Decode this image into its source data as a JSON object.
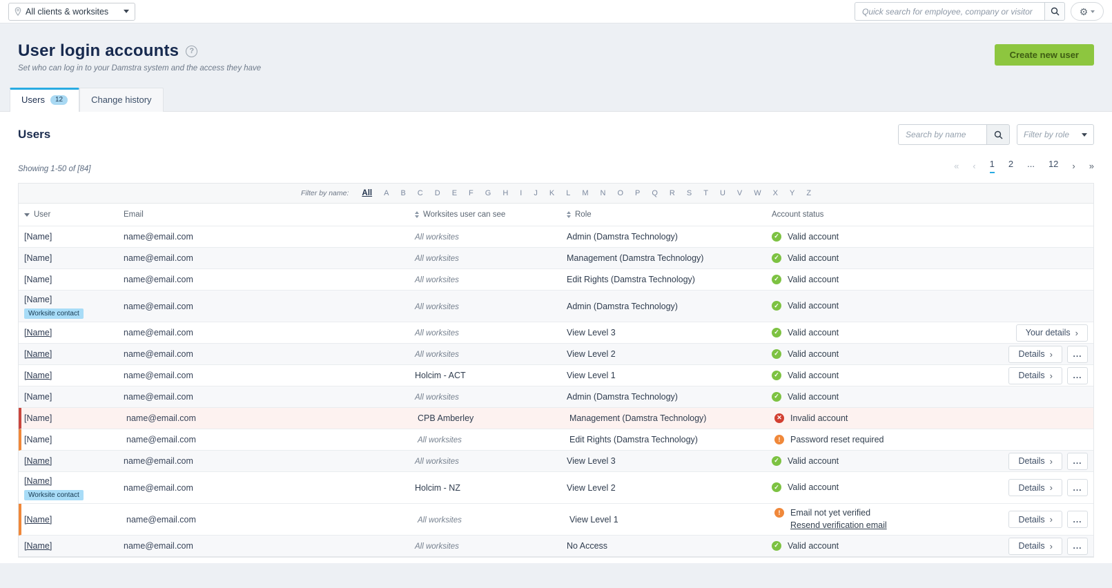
{
  "topbar": {
    "scope_selector": {
      "label": "All clients & worksites"
    },
    "quick_search": {
      "placeholder": "Quick search for employee, company or visitor"
    }
  },
  "header": {
    "title": "User login accounts",
    "help": "?",
    "subtitle": "Set who can log in to your Damstra system and the access they have",
    "create_button": "Create new user"
  },
  "tabs": {
    "users_label": "Users",
    "users_badge": "12",
    "history_label": "Change history"
  },
  "users_section": {
    "heading": "Users",
    "search_placeholder": "Search by name",
    "role_filter_placeholder": "Filter by role",
    "showing": "Showing 1-50 of [84]",
    "pagination": {
      "first": "«",
      "prev": "‹",
      "next": "›",
      "last": "»",
      "pages": [
        {
          "label": "1",
          "active": true
        },
        {
          "label": "2",
          "active": false
        },
        {
          "label": "...",
          "active": false,
          "dots": true
        },
        {
          "label": "12",
          "active": false
        }
      ]
    },
    "name_filter": {
      "label": "Filter by name:",
      "all": "All",
      "letters": [
        "A",
        "B",
        "C",
        "D",
        "E",
        "F",
        "G",
        "H",
        "I",
        "J",
        "K",
        "L",
        "M",
        "N",
        "O",
        "P",
        "Q",
        "R",
        "S",
        "T",
        "U",
        "V",
        "W",
        "X",
        "Y",
        "Z"
      ]
    }
  },
  "table": {
    "columns": {
      "user": "User",
      "email": "Email",
      "worksites": "Worksites user can see",
      "role": "Role",
      "status": "Account status"
    },
    "action_labels": {
      "your_details": "Your details",
      "details": "Details",
      "menu": "...",
      "chevron": "›"
    },
    "rows": [
      {
        "user": "[Name]",
        "link": false,
        "badge": null,
        "email": "name@email.com",
        "worksites": "All worksites",
        "all_worksites": true,
        "role": "Admin (Damstra Technology)",
        "status": {
          "type": "valid",
          "text": "Valid account"
        },
        "actions": [],
        "stripe": false,
        "accent": null,
        "tall": false
      },
      {
        "user": "[Name]",
        "link": false,
        "badge": null,
        "email": "name@email.com",
        "worksites": "All worksites",
        "all_worksites": true,
        "role": "Management (Damstra Technology)",
        "status": {
          "type": "valid",
          "text": "Valid account"
        },
        "actions": [],
        "stripe": true,
        "accent": null,
        "tall": false
      },
      {
        "user": "[Name]",
        "link": false,
        "badge": null,
        "email": "name@email.com",
        "worksites": "All worksites",
        "all_worksites": true,
        "role": "Edit Rights (Damstra Technology)",
        "status": {
          "type": "valid",
          "text": "Valid account"
        },
        "actions": [],
        "stripe": false,
        "accent": null,
        "tall": false
      },
      {
        "user": "[Name]",
        "link": false,
        "badge": "Worksite contact",
        "email": "name@email.com",
        "worksites": "All worksites",
        "all_worksites": true,
        "role": "Admin (Damstra Technology)",
        "status": {
          "type": "valid",
          "text": "Valid account"
        },
        "actions": [],
        "stripe": true,
        "accent": null,
        "tall": true
      },
      {
        "user": "[Name]",
        "link": true,
        "badge": null,
        "email": "name@email.com",
        "worksites": "All worksites",
        "all_worksites": true,
        "role": "View Level 3",
        "status": {
          "type": "valid",
          "text": "Valid account"
        },
        "actions": [
          "your_details"
        ],
        "stripe": false,
        "accent": null,
        "tall": false
      },
      {
        "user": "[Name]",
        "link": true,
        "badge": null,
        "email": "name@email.com",
        "worksites": "All worksites",
        "all_worksites": true,
        "role": "View Level 2",
        "status": {
          "type": "valid",
          "text": "Valid account"
        },
        "actions": [
          "details",
          "menu"
        ],
        "stripe": true,
        "accent": null,
        "tall": false
      },
      {
        "user": "[Name]",
        "link": true,
        "badge": null,
        "email": "name@email.com",
        "worksites": "Holcim - ACT",
        "all_worksites": false,
        "role": "View Level 1",
        "status": {
          "type": "valid",
          "text": "Valid account"
        },
        "actions": [
          "details",
          "menu"
        ],
        "stripe": false,
        "accent": null,
        "tall": false
      },
      {
        "user": "[Name]",
        "link": false,
        "badge": null,
        "email": "name@email.com",
        "worksites": "All worksites",
        "all_worksites": true,
        "role": "Admin (Damstra Technology)",
        "status": {
          "type": "valid",
          "text": "Valid account"
        },
        "actions": [],
        "stripe": true,
        "accent": null,
        "tall": false
      },
      {
        "user": "[Name]",
        "link": false,
        "badge": null,
        "email": "name@email.com",
        "worksites": "CPB Amberley",
        "all_worksites": false,
        "role": "Management (Damstra Technology)",
        "status": {
          "type": "invalid",
          "text": "Invalid account"
        },
        "actions": [],
        "stripe": false,
        "accent": "red",
        "invalid_bg": true,
        "tall": false
      },
      {
        "user": "[Name]",
        "link": false,
        "badge": null,
        "email": "name@email.com",
        "worksites": "All worksites",
        "all_worksites": true,
        "role": "Edit Rights (Damstra Technology)",
        "status": {
          "type": "warning",
          "text": "Password reset required"
        },
        "actions": [],
        "stripe": false,
        "accent": "orange",
        "tall": false
      },
      {
        "user": "[Name]",
        "link": true,
        "badge": null,
        "email": "name@email.com",
        "worksites": "All worksites",
        "all_worksites": true,
        "role": "View Level 3",
        "status": {
          "type": "valid",
          "text": "Valid account"
        },
        "actions": [
          "details",
          "menu"
        ],
        "stripe": true,
        "accent": null,
        "tall": false
      },
      {
        "user": "[Name]",
        "link": true,
        "badge": "Worksite contact",
        "email": "name@email.com",
        "worksites": "Holcim - NZ",
        "all_worksites": false,
        "role": "View Level 2",
        "status": {
          "type": "valid",
          "text": "Valid account"
        },
        "actions": [
          "details",
          "menu"
        ],
        "stripe": false,
        "accent": null,
        "tall": true
      },
      {
        "user": "[Name]",
        "link": true,
        "badge": null,
        "email": "name@email.com",
        "worksites": "All worksites",
        "all_worksites": true,
        "role": "View Level 1",
        "status": {
          "type": "warning",
          "text": "Email not yet verified",
          "link": "Resend verification email"
        },
        "actions": [
          "details",
          "menu"
        ],
        "stripe": false,
        "accent": "orange",
        "tall": true
      },
      {
        "user": "[Name]",
        "link": true,
        "badge": null,
        "email": "name@email.com",
        "worksites": "All worksites",
        "all_worksites": true,
        "role": "No Access",
        "status": {
          "type": "valid",
          "text": "Valid account"
        },
        "actions": [
          "details",
          "menu"
        ],
        "stripe": true,
        "accent": null,
        "tall": false
      }
    ]
  },
  "colors": {
    "green": "#8dc63f",
    "green_text": "#3d5c12",
    "blue": "#29abe2",
    "valid": "#7dc242",
    "invalid": "#d23f31",
    "warning": "#f0883a",
    "badge_bg": "#a8dcf7",
    "accent_red": "#c9463d",
    "accent_orange": "#f0883a"
  }
}
